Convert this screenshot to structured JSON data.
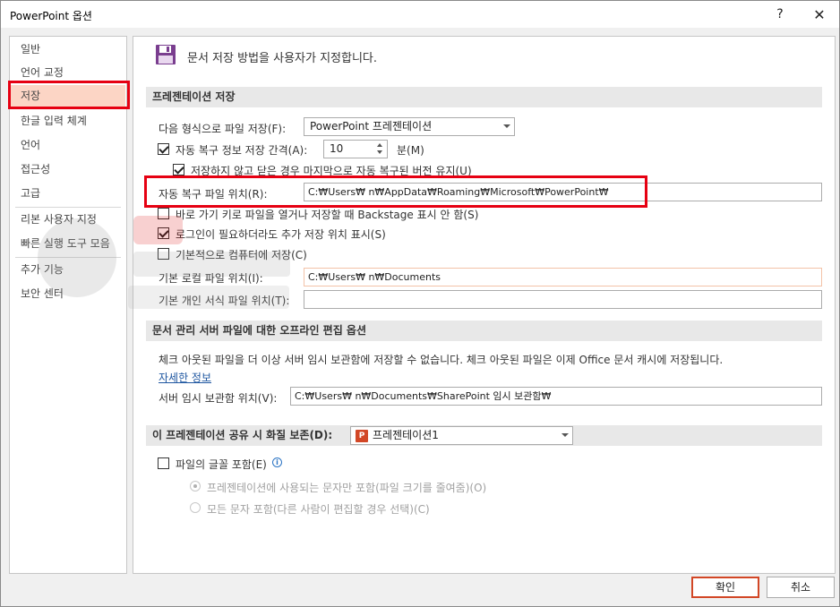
{
  "window": {
    "title": "PowerPoint 옵션",
    "help_label": "?",
    "close_label": "✕"
  },
  "nav": {
    "items": [
      {
        "label": "일반"
      },
      {
        "label": "언어 교정"
      },
      {
        "label": "저장"
      },
      {
        "label": "한글 입력 체계"
      },
      {
        "label": "언어"
      },
      {
        "label": "접근성"
      },
      {
        "label": "고급"
      },
      {
        "label": "리본 사용자 지정"
      },
      {
        "label": "빠른 실행 도구 모음"
      },
      {
        "label": "추가 기능"
      },
      {
        "label": "보안 센터"
      }
    ],
    "selected": "저장"
  },
  "header": {
    "text": "문서 저장 방법을 사용자가 지정합니다.",
    "icon": "floppy-disk-icon"
  },
  "save_section": {
    "title": "프레젠테이션 저장",
    "format_label": "다음 형식으로 파일 저장(F):",
    "format_value": "PowerPoint 프레젠테이션",
    "autorecover_label": "자동 복구 정보 저장 간격(A):",
    "autorecover_value": "10",
    "minutes_label": "분(M)",
    "keep_last_label": "저장하지 않고 닫은 경우 마지막으로 자동 복구된 버전 유지(U)",
    "autorecover_location_label": "자동 복구 파일 위치(R):",
    "autorecover_location_value": "C:₩Users₩          n₩AppData₩Roaming₩Microsoft₩PowerPoint₩",
    "backstage_label": "바로 가기 키로 파일을 열거나 저장할 때 Backstage 표시 안 함(S)",
    "additional_places_label": "로그인이 필요하더라도 추가 저장 위치 표시(S)",
    "save_to_computer_label": "기본적으로 컴퓨터에 저장(C)",
    "default_local_label": "기본 로컬 파일 위치(I):",
    "default_local_value": "C:₩Users₩          n₩Documents",
    "personal_templates_label": "기본 개인 서식 파일 위치(T):",
    "personal_templates_value": ""
  },
  "offline_section": {
    "title": "문서 관리 서버 파일에 대한 오프라인 편집 옵션",
    "description": "체크 아웃된 파일을 더 이상 서버 임시 보관함에 저장할 수 없습니다. 체크 아웃된 파일은 이제 Office 문서 캐시에 저장됩니다.",
    "more_info_label": "자세한 정보",
    "drafts_label": "서버 임시 보관함 위치(V):",
    "drafts_value": "C:₩Users₩          n₩Documents₩SharePoint 임시 보관함₩"
  },
  "fidelity_section": {
    "title": "이 프레젠테이션 공유 시 화질 보존(D):",
    "presentation_value": "프레젠테이션1",
    "presentation_icon_letter": "P",
    "embed_fonts_label": "파일의 글꼴 포함(E)",
    "info_label": "i",
    "embed_used_label": "프레젠테이션에 사용되는 문자만 포함(파일 크기를 줄여줌)(O)",
    "embed_all_label": "모든 문자 포함(다른 사람이 편집할 경우 선택)(C)"
  },
  "footer": {
    "ok_label": "확인",
    "cancel_label": "취소"
  },
  "colors": {
    "selection": "#fcd5c5",
    "highlight_box": "#e60012",
    "accent": "#d24726",
    "link": "#1e56a0"
  }
}
